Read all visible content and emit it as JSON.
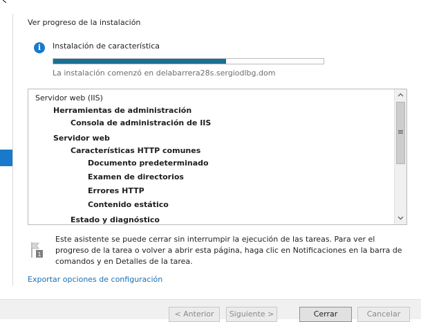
{
  "heading": "Ver progreso de la instalación",
  "status": {
    "label": "Instalación de característica",
    "progress_fraction": 0.64,
    "started_text": "La instalación comenzó en delabarrera28s.sergiodlbg.dom"
  },
  "tree": {
    "items": [
      {
        "text": "Servidor web (IIS)",
        "level": 0
      },
      {
        "text": "Herramientas de administración",
        "level": 1
      },
      {
        "text": "Consola de administración de IIS",
        "level": 2
      },
      {
        "text": "Servidor web",
        "level": 1
      },
      {
        "text": "Características HTTP comunes",
        "level": 2
      },
      {
        "text": "Documento predeterminado",
        "level": 3
      },
      {
        "text": "Examen de directorios",
        "level": 3
      },
      {
        "text": "Errores HTTP",
        "level": 3
      },
      {
        "text": "Contenido estático",
        "level": 3
      },
      {
        "text": "Estado y diagnóstico",
        "level": 2
      }
    ]
  },
  "note": {
    "text": "Este asistente se puede cerrar sin interrumpir la ejecución de las tareas. Para ver el progreso de la tarea o volver a abrir esta página, haga clic en Notificaciones en la barra de comandos y en Detalles de la tarea.",
    "badge": "1"
  },
  "export_link": "Exportar opciones de configuración",
  "buttons": {
    "previous": "< Anterior",
    "next": "Siguiente >",
    "close": "Cerrar",
    "cancel": "Cancelar"
  },
  "colors": {
    "accent": "#1979ca",
    "progress": "#1a6f95",
    "link": "#1a6fb5"
  }
}
